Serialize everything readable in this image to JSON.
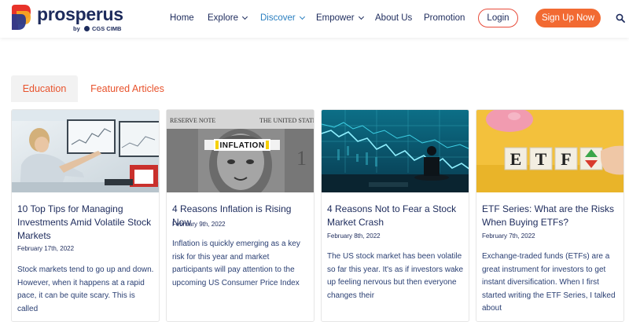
{
  "brand": {
    "name": "prosperus",
    "by": "by",
    "partner": "CGS CIMB"
  },
  "nav": {
    "items": [
      {
        "label": "Home"
      },
      {
        "label": "Explore"
      },
      {
        "label": "Discover"
      },
      {
        "label": "Empower"
      },
      {
        "label": "About Us"
      },
      {
        "label": "Promotion"
      }
    ],
    "login_label": "Login",
    "signup_label": "Sign Up Now"
  },
  "tabs": [
    {
      "label": "Education",
      "active": true
    },
    {
      "label": "Featured Articles",
      "active": false
    }
  ],
  "articles": [
    {
      "title": "10 Top Tips for Managing Investments Amid Volatile Stock Markets",
      "date": "February 17th, 2022",
      "excerpt": "Stock markets tend to go up and down. However, when it happens at a rapid pace, it can be quite scary. This is called"
    },
    {
      "title": "4 Reasons Inflation is Rising Now",
      "date": "February 9th, 2022",
      "excerpt": "Inflation is quickly emerging as a key risk for this year and market participants will pay attention to the upcoming US Consumer Price Index",
      "image_caption": "INFLATION",
      "image_text_left": "RESERVE NOTE",
      "image_text_right": "THE UNITED STATES"
    },
    {
      "title": "4 Reasons Not to Fear a Stock Market Crash",
      "date": "February 8th, 2022",
      "excerpt": "The US stock market has been volatile so far this year. It's as if investors wake up feeling nervous but then everyone changes their"
    },
    {
      "title": "ETF Series: What are the Risks When Buying ETFs?",
      "date": "February 7th, 2022",
      "excerpt": "Exchange-traded funds (ETFs) are a great instrument for investors to get instant diversification. When I first started writing the ETF Series, I talked about",
      "image_blocks": [
        "E",
        "T",
        "F"
      ]
    }
  ],
  "colors": {
    "navy": "#1d2b5c",
    "accent_orange": "#f26a32",
    "tab_orange": "#e8532d",
    "active_nav": "#2a7fc0"
  }
}
